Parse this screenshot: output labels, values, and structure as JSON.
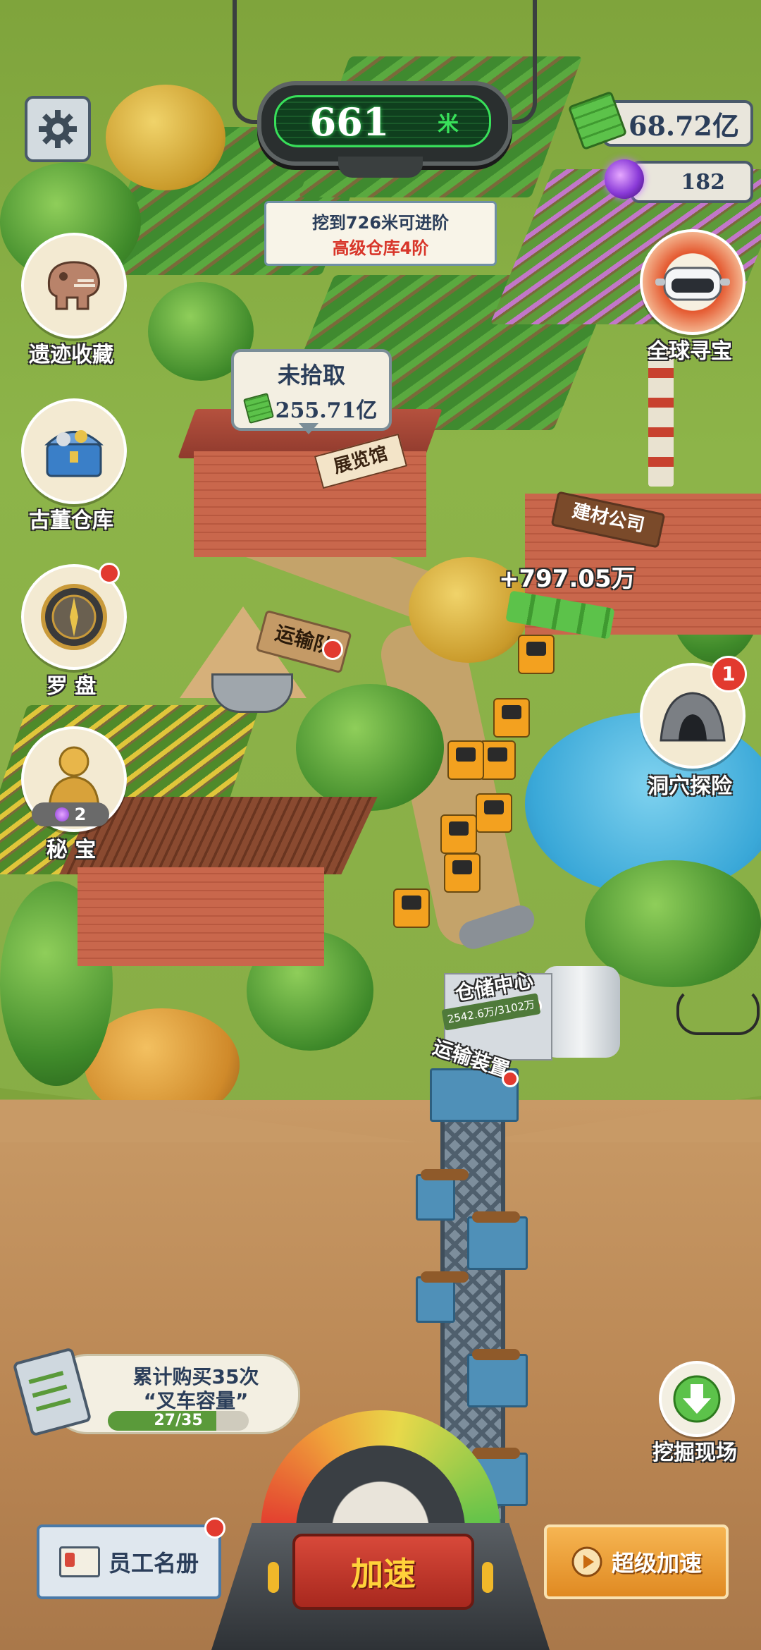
{
  "depth": {
    "value": "661",
    "unit": "米"
  },
  "currency": {
    "cash": "68.72亿",
    "gems": "182"
  },
  "advance_notice": {
    "line1": "挖到726米可进阶",
    "line2": "高级仓库4阶"
  },
  "left_menu": [
    {
      "label": "遗迹收藏",
      "icon": "dinosaur-fossil-icon"
    },
    {
      "label": "古董仓库",
      "icon": "treasure-chest-icon"
    },
    {
      "label": "罗 盘",
      "icon": "compass-icon"
    },
    {
      "label": "秘 宝",
      "icon": "golden-buddha-icon",
      "count": "2"
    }
  ],
  "right_menu": [
    {
      "label": "全球寻宝",
      "icon": "vr-headset-icon"
    },
    {
      "label": "洞穴探险",
      "icon": "cave-icon",
      "badge": "1"
    },
    {
      "label": "挖掘现场",
      "icon": "down-arrow-icon"
    }
  ],
  "pickup": {
    "title": "未拾取",
    "amount": "255.71亿"
  },
  "buildings": {
    "museum": "展览馆",
    "factory": "建材公司",
    "transport": "运输队",
    "storage": "仓储中心",
    "storage_capacity": "2542.6万/3102万",
    "conveyor": "运输装置"
  },
  "income_popup": "+797.05万",
  "task": {
    "line1": "累计购买35次",
    "line2": "“叉车容量”",
    "progress_text": "27/35",
    "progress": 0.771
  },
  "bottom": {
    "staff": "员工名册",
    "speed": "加速",
    "super_speed": "超级加速"
  },
  "colors": {
    "accent_green": "#38e05a",
    "gem_purple": "#8a3ad8",
    "speed_red": "#c8352a",
    "super_orange": "#f0a23a"
  }
}
